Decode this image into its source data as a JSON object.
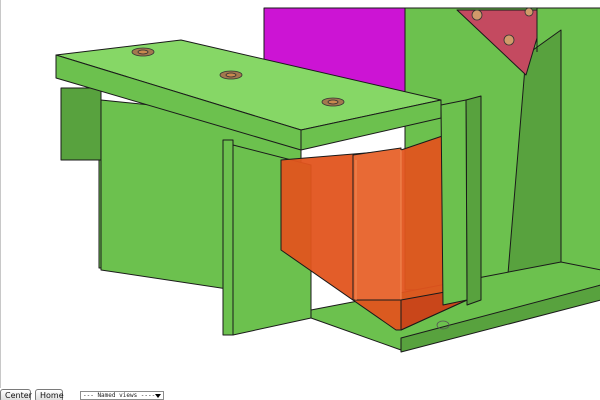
{
  "viewport": {
    "name": "3d-model-view"
  },
  "toolbar": {
    "center_label": "Center",
    "home_label": "Home",
    "named_views_selected": "--- Named views ----"
  },
  "colors": {
    "plate_green": "#6cc14e",
    "plate_green_dark": "#58a23e",
    "plate_green_light": "#86d766",
    "orange_part": "#e2541e",
    "magenta_part": "#cc14d4",
    "red_gusset": "#c44a60",
    "edge": "#1a1a1a"
  }
}
